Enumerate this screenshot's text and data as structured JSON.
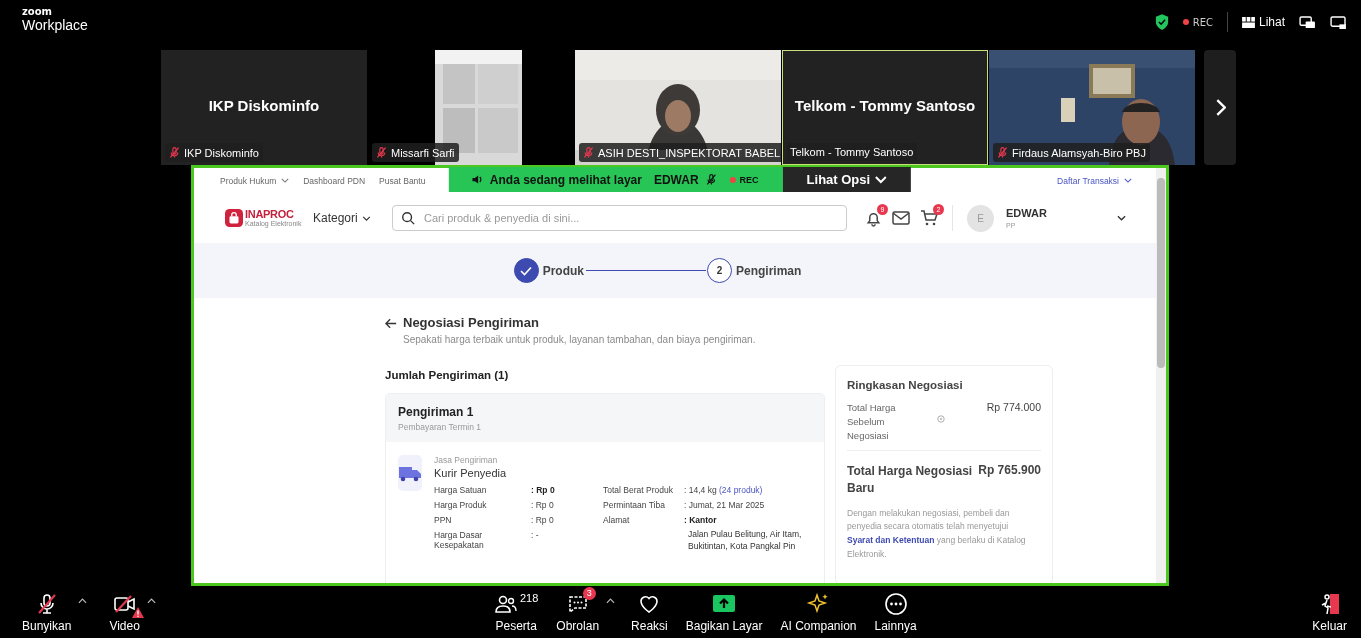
{
  "app": {
    "brand": "zoom",
    "product": "Workplace"
  },
  "top_bar": {
    "recording": "REC",
    "view_label": "Lihat"
  },
  "participants": [
    {
      "kind": "name",
      "tile_title": "IKP Diskominfo",
      "name": "IKP Diskominfo",
      "muted": true,
      "active_speaker": false
    },
    {
      "kind": "ceiling",
      "name": "Missarfi Sarfi",
      "muted": true,
      "active_speaker": false
    },
    {
      "kind": "person",
      "name": "ASIH DESTI_INSPEKTORAT BABEL",
      "muted": true,
      "active_speaker": false
    },
    {
      "kind": "name",
      "tile_title": "Telkom - Tommy Santoso",
      "name": "Telkom - Tommy Santoso",
      "muted": false,
      "active_speaker": true
    },
    {
      "kind": "office",
      "name": "Firdaus Alamsyah-Biro PBJ",
      "muted": true,
      "active_speaker": false
    }
  ],
  "share_banner": {
    "text": "Anda sedang melihat layar",
    "presenter": "EDWAR",
    "presenter_muted": true,
    "recording": "REC",
    "options": "Lihat Opsi"
  },
  "shared_page": {
    "top_links": [
      {
        "label": "Produk Hukum",
        "dropdown": true
      },
      {
        "label": "Dashboard PDN",
        "dropdown": false
      },
      {
        "label": "Pusat Bantu",
        "dropdown": false
      }
    ],
    "transactions_link": "Daftar Transaksi",
    "logo": {
      "name": "INAPROC",
      "tagline": "Katalog Elektronik"
    },
    "category_menu": "Kategori",
    "search": {
      "placeholder": "Cari produk & penyedia di sini..."
    },
    "notifications_count": "9",
    "cart_count": "2",
    "user": {
      "initial": "E",
      "name": "EDWAR",
      "role": "PP"
    },
    "steps": [
      {
        "label": "Produk",
        "done": true
      },
      {
        "label": "Pengiriman",
        "done": false,
        "number": "2"
      }
    ],
    "title": "Negosiasi Pengiriman",
    "subtitle": "Sepakati harga terbaik untuk produk, layanan tambahan, dan biaya pengiriman.",
    "shipments_heading": "Jumlah Pengiriman (1)",
    "shipment": {
      "title": "Pengiriman 1",
      "subtitle": "Pembayaran Termin 1",
      "service_label": "Jasa Pengiriman",
      "service": "Kurir Penyedia",
      "left_rows": [
        {
          "label": "Harga Satuan",
          "value": ": Rp 0",
          "bold": true
        },
        {
          "label": "Harga Produk",
          "value": ": Rp 0",
          "bold": false
        },
        {
          "label": "PPN",
          "value": ": Rp 0",
          "bold": false
        },
        {
          "label": "Harga Dasar Kesepakatan",
          "value": ": -",
          "bold": false
        }
      ],
      "weight_label": "Total Berat Produk",
      "weight_value": ": 14,4 kg",
      "weight_link": "(24 produk)",
      "arrival_label": "Permintaan Tiba",
      "arrival_value": ": Jumat, 21 Mar 2025",
      "address_label": "Alamat",
      "address_name": ": Kantor",
      "address": "Jalan Pulau Belitung, Air Itam, Bukitintan, Kota Pangkal Pin"
    },
    "summary": {
      "title": "Ringkasan Negosiasi",
      "before_label": "Total Harga Sebelum Negosiasi",
      "before_value": "Rp 774.000",
      "after_label": "Total Harga Negosiasi Baru",
      "after_value": "Rp 765.900",
      "note_before": "Dengan melakukan negosiasi, pembeli dan penyedia secara otomatis telah menyetujui",
      "note_link": "Syarat dan Ketentuan",
      "note_after": "yang berlaku di Katalog Elektronik."
    }
  },
  "toolbar": [
    {
      "kind": "mic",
      "label": "Bunyikan",
      "menu": true,
      "alert": false
    },
    {
      "kind": "video",
      "label": "Video",
      "menu": true,
      "alert": true
    },
    {
      "kind": "participants",
      "label": "Peserta",
      "count": "218",
      "menu": false,
      "alert": false
    },
    {
      "kind": "chat",
      "label": "Obrolan",
      "badge": "3",
      "menu": true,
      "alert": false
    },
    {
      "kind": "reactions",
      "label": "Reaksi",
      "menu": false,
      "alert": false
    },
    {
      "kind": "share",
      "label": "Bagikan Layar",
      "menu": false,
      "alert": false
    },
    {
      "kind": "ai",
      "label": "AI Companion",
      "menu": false,
      "alert": false
    },
    {
      "kind": "more",
      "label": "Lainnya",
      "menu": false,
      "alert": false
    },
    {
      "kind": "leave",
      "label": "Keluar",
      "menu": false,
      "alert": false
    }
  ]
}
